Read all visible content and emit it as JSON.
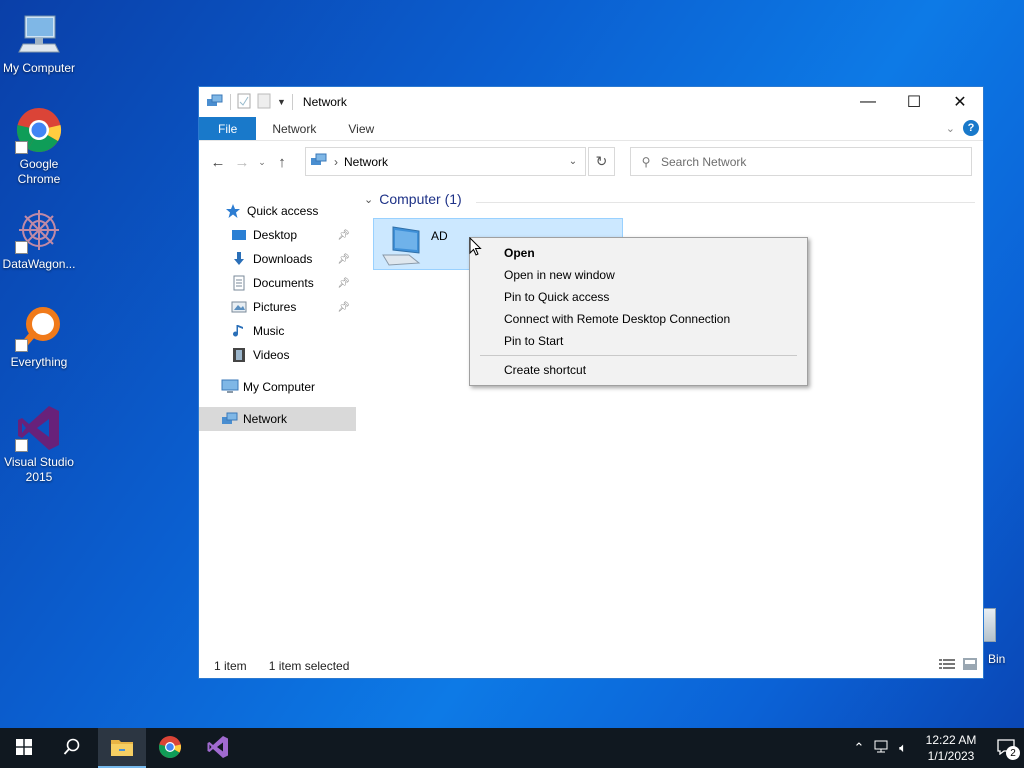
{
  "desktop": {
    "icons": [
      {
        "label": "My Computer",
        "icon": "computer-icon"
      },
      {
        "label": "Google Chrome",
        "icon": "chrome-icon"
      },
      {
        "label": "DataWagon...",
        "icon": "datawagon-icon"
      },
      {
        "label": "Everything",
        "icon": "everything-search-icon"
      },
      {
        "label": "Visual Studio 2015",
        "icon": "visual-studio-icon"
      }
    ],
    "recycle_bin_label": "Bin"
  },
  "window": {
    "title": "Network",
    "controls": {
      "minimize": "—",
      "maximize": "☐",
      "close": "✕"
    },
    "ribbon_tabs": [
      "File",
      "Network",
      "View"
    ],
    "help_label": "?",
    "address_crumb": "Network",
    "search_placeholder": "Search Network",
    "sidebar": {
      "items": [
        {
          "label": "Quick access",
          "icon": "star-icon",
          "pinned": false
        },
        {
          "label": "Desktop",
          "icon": "desktop-folder-icon",
          "pinned": true
        },
        {
          "label": "Downloads",
          "icon": "downloads-icon",
          "pinned": true
        },
        {
          "label": "Documents",
          "icon": "documents-icon",
          "pinned": true
        },
        {
          "label": "Pictures",
          "icon": "pictures-icon",
          "pinned": true
        },
        {
          "label": "Music",
          "icon": "music-icon",
          "pinned": false
        },
        {
          "label": "Videos",
          "icon": "videos-icon",
          "pinned": false
        },
        {
          "label": "My Computer",
          "icon": "computer-icon",
          "pinned": false
        },
        {
          "label": "Network",
          "icon": "network-icon",
          "pinned": false,
          "selected": true
        }
      ]
    },
    "content": {
      "group_header": "Computer (1)",
      "items": [
        {
          "label": "AD",
          "icon": "computer-icon",
          "selected": true
        }
      ]
    },
    "status": {
      "item_count": "1 item",
      "selection": "1 item selected"
    }
  },
  "context_menu": {
    "items": [
      {
        "label": "Open",
        "bold": true
      },
      {
        "label": "Open in new window"
      },
      {
        "label": "Pin to Quick access"
      },
      {
        "label": "Connect with Remote Desktop Connection"
      },
      {
        "label": "Pin to Start"
      },
      {
        "separator": true
      },
      {
        "label": "Create shortcut"
      }
    ]
  },
  "taskbar": {
    "buttons": [
      {
        "name": "start-button",
        "icon": "windows-logo-icon"
      },
      {
        "name": "search-button",
        "icon": "search-icon"
      },
      {
        "name": "file-explorer-button",
        "icon": "folder-icon",
        "active": true
      },
      {
        "name": "chrome-button",
        "icon": "chrome-icon"
      },
      {
        "name": "visual-studio-button",
        "icon": "visual-studio-icon"
      }
    ],
    "clock_time": "12:22 AM",
    "clock_date": "1/1/2023",
    "notification_count": "2"
  },
  "colors": {
    "accent": "#1979ca",
    "selection": "#cce8ff",
    "taskbar": "#101820",
    "group_header": "#1e3287"
  }
}
